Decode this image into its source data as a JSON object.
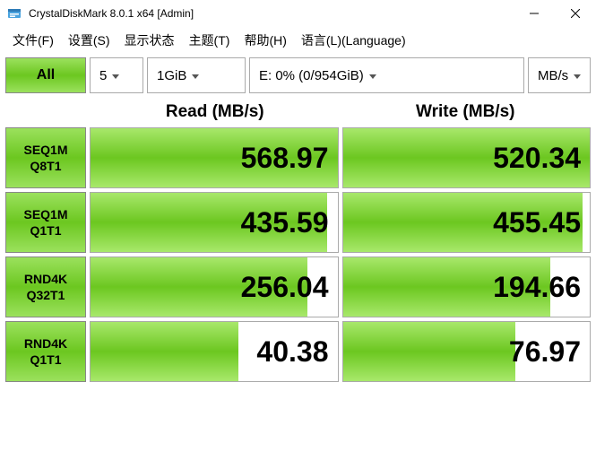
{
  "titlebar": {
    "text": "CrystalDiskMark 8.0.1 x64 [Admin]"
  },
  "menu": {
    "file": "文件(F)",
    "settings": "设置(S)",
    "display": "显示状态",
    "theme": "主题(T)",
    "help": "帮助(H)",
    "language": "语言(L)(Language)"
  },
  "toolbar": {
    "all": "All",
    "runs": "5",
    "size": "1GiB",
    "target": "E: 0% (0/954GiB)",
    "unit": "MB/s"
  },
  "headers": {
    "read": "Read (MB/s)",
    "write": "Write (MB/s)"
  },
  "rows": [
    {
      "label1": "SEQ1M",
      "label2": "Q8T1",
      "read": "568.97",
      "read_pct": 100,
      "write": "520.34",
      "write_pct": 100
    },
    {
      "label1": "SEQ1M",
      "label2": "Q1T1",
      "read": "435.59",
      "read_pct": 96,
      "write": "455.45",
      "write_pct": 97
    },
    {
      "label1": "RND4K",
      "label2": "Q32T1",
      "read": "256.04",
      "read_pct": 88,
      "write": "194.66",
      "write_pct": 84
    },
    {
      "label1": "RND4K",
      "label2": "Q1T1",
      "read": "40.38",
      "read_pct": 60,
      "write": "76.97",
      "write_pct": 70
    }
  ],
  "chart_data": {
    "type": "table",
    "title": "CrystalDiskMark 8.0.1 Benchmark Results",
    "columns": [
      "Test",
      "Read (MB/s)",
      "Write (MB/s)"
    ],
    "rows": [
      [
        "SEQ1M Q8T1",
        568.97,
        520.34
      ],
      [
        "SEQ1M Q1T1",
        435.59,
        455.45
      ],
      [
        "RND4K Q32T1",
        256.04,
        194.66
      ],
      [
        "RND4K Q1T1",
        40.38,
        76.97
      ]
    ],
    "target": "E: 0% (0/954GiB)",
    "runs": 5,
    "block_size": "1GiB"
  }
}
